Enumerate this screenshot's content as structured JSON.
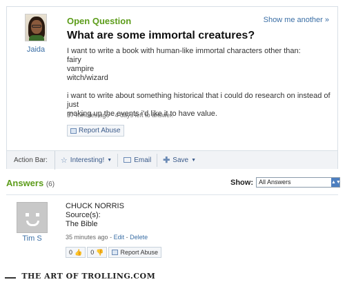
{
  "question": {
    "type_label": "Open Question",
    "show_another": "Show me another »",
    "title": "What are some immortal creatures?",
    "asker": "Jaida",
    "body_lines": [
      "I want to write a book with human-like immortal characters other than:",
      "fairy",
      "vampire",
      "witch/wizard",
      "",
      "i want to write about something historical that i could do research on instead of just",
      "making up the events i'd like it to have value."
    ],
    "meta": "37 minutes ago - 4 days left to answer.",
    "report_label": "Report Abuse"
  },
  "action_bar": {
    "label": "Action Bar:",
    "interesting": "Interesting!",
    "email": "Email",
    "save": "Save"
  },
  "answers": {
    "heading": "Answers",
    "count": "(6)",
    "show_label": "Show:",
    "filter_value": "All Answers"
  },
  "answer": {
    "author": "Tim S",
    "text": "CHUCK NORRIS",
    "source_label": "Source(s):",
    "source": "The Bible",
    "time": "35 minutes ago",
    "edit": "Edit",
    "delete": "Delete",
    "up_count": "0",
    "down_count": "0",
    "report_label": "Report Abuse"
  },
  "watermark": "THE ART OF TROLLING.COM"
}
